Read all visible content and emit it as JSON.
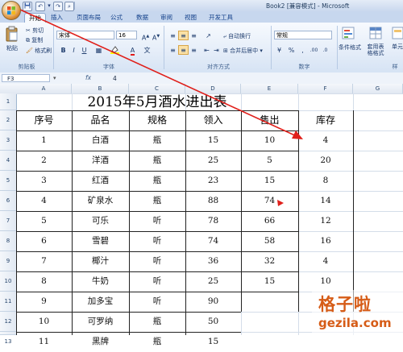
{
  "window": {
    "title": "Book2 [兼容模式] - Microsoft"
  },
  "ribbon": {
    "tabs": [
      "开始",
      "插入",
      "页面布局",
      "公式",
      "数据",
      "审阅",
      "视图",
      "开发工具"
    ],
    "active_tab": "开始",
    "clipboard": {
      "paste": "粘贴",
      "cut": "剪切",
      "copy": "复制",
      "format_painter": "格式刷",
      "label": "剪贴板"
    },
    "font": {
      "name": "宋体",
      "size": "16",
      "label": "字体"
    },
    "alignment": {
      "wrap": "自动换行",
      "merge": "合并后居中",
      "label": "对齐方式"
    },
    "number": {
      "format": "常规",
      "label": "数字"
    },
    "styles": {
      "conditional": "条件格式",
      "table_format": "套用表格格式",
      "cell_styles": "单元格样式",
      "label": "样"
    }
  },
  "formula_bar": {
    "name_box": "F3",
    "fx": "fx",
    "value": "4"
  },
  "columns": [
    "A",
    "B",
    "C",
    "D",
    "E",
    "F",
    "G"
  ],
  "rows": [
    "1",
    "2",
    "3",
    "4",
    "5",
    "6",
    "7",
    "8",
    "9",
    "10",
    "11",
    "12",
    "13"
  ],
  "table": {
    "title": "2015年5月酒水进出表",
    "headers": [
      "序号",
      "品名",
      "规格",
      "领入",
      "售出",
      "库存"
    ],
    "rows": [
      [
        "1",
        "白酒",
        "瓶",
        "15",
        "10",
        "4"
      ],
      [
        "2",
        "洋酒",
        "瓶",
        "25",
        "5",
        "20"
      ],
      [
        "3",
        "红酒",
        "瓶",
        "23",
        "15",
        "8"
      ],
      [
        "4",
        "矿泉水",
        "瓶",
        "88",
        "74",
        "14"
      ],
      [
        "5",
        "可乐",
        "听",
        "78",
        "66",
        "12"
      ],
      [
        "6",
        "雪碧",
        "听",
        "74",
        "58",
        "16"
      ],
      [
        "7",
        "椰汁",
        "听",
        "36",
        "32",
        "4"
      ],
      [
        "8",
        "牛奶",
        "听",
        "25",
        "15",
        "10"
      ],
      [
        "9",
        "加多宝",
        "听",
        "90",
        "",
        ""
      ],
      [
        "10",
        "可罗纳",
        "瓶",
        "50",
        "",
        ""
      ],
      [
        "11",
        "黑牌",
        "瓶",
        "15",
        "",
        ""
      ]
    ]
  },
  "watermark": {
    "cn": "格子啦",
    "en": "gezila.com"
  },
  "colors": {
    "annotation_arrow": "#e0201b",
    "watermark": "#d65c17"
  }
}
